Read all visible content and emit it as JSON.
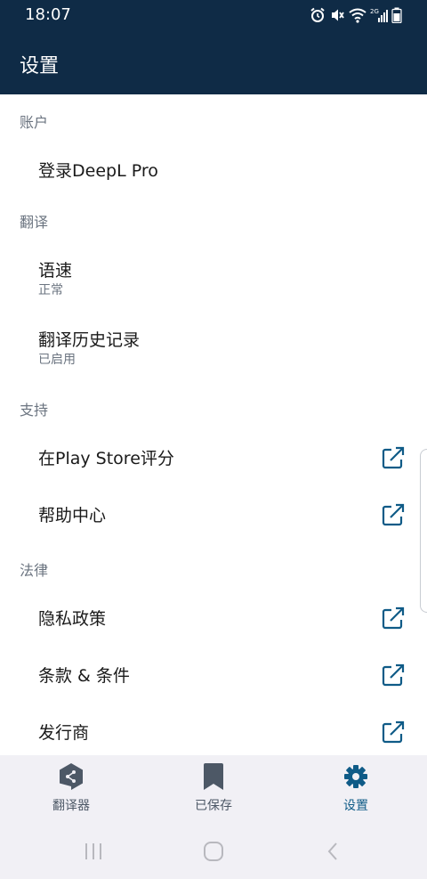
{
  "status_bar": {
    "time": "18:07",
    "network": "2G"
  },
  "app_bar": {
    "title": "设置"
  },
  "sections": {
    "account": {
      "header": "账户",
      "items": [
        {
          "title": "登录DeepL Pro"
        }
      ]
    },
    "translation": {
      "header": "翻译",
      "items": [
        {
          "title": "语速",
          "subtitle": "正常"
        },
        {
          "title": "翻译历史记录",
          "subtitle": "已启用"
        }
      ]
    },
    "support": {
      "header": "支持",
      "items": [
        {
          "title": "在Play Store评分",
          "icon": "external-link-icon"
        },
        {
          "title": "帮助中心",
          "icon": "external-link-icon"
        }
      ]
    },
    "legal": {
      "header": "法律",
      "items": [
        {
          "title": "隐私政策",
          "icon": "external-link-icon"
        },
        {
          "title": "条款 & 条件",
          "icon": "external-link-icon"
        },
        {
          "title": "发行商",
          "icon": "external-link-icon"
        }
      ]
    }
  },
  "bottom_nav": [
    {
      "label": "翻译器",
      "icon": "translator-icon"
    },
    {
      "label": "已保存",
      "icon": "bookmark-icon"
    },
    {
      "label": "设置",
      "icon": "gear-icon",
      "active": true
    }
  ],
  "colors": {
    "header_bg": "#0f2b46",
    "accent": "#0f5b87",
    "muted_text": "#6b7480",
    "nav_bg": "#f1f0f5"
  }
}
